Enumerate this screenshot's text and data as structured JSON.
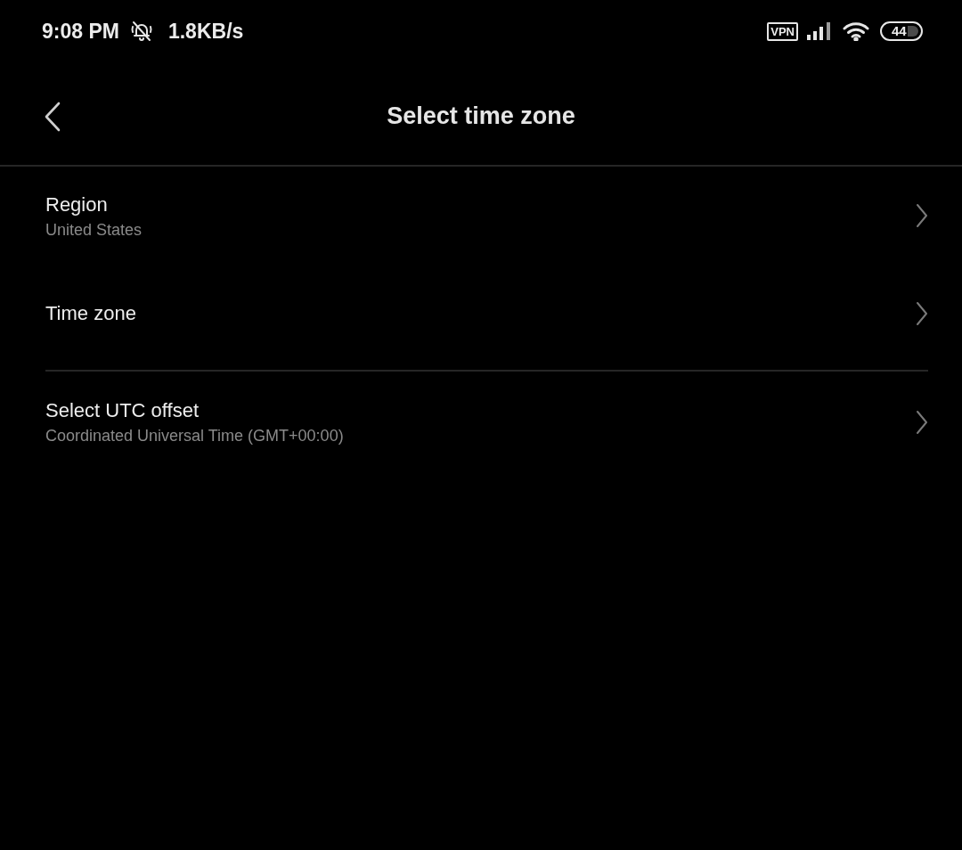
{
  "status_bar": {
    "time": "9:08 PM",
    "network_speed": "1.8KB/s",
    "vpn_label": "VPN",
    "battery_percent": "44"
  },
  "header": {
    "title": "Select time zone"
  },
  "sections": [
    {
      "items": [
        {
          "title": "Region",
          "subtitle": "United States"
        },
        {
          "title": "Time zone"
        }
      ]
    },
    {
      "items": [
        {
          "title": "Select UTC offset",
          "subtitle": "Coordinated Universal Time (GMT+00:00)"
        }
      ]
    }
  ]
}
